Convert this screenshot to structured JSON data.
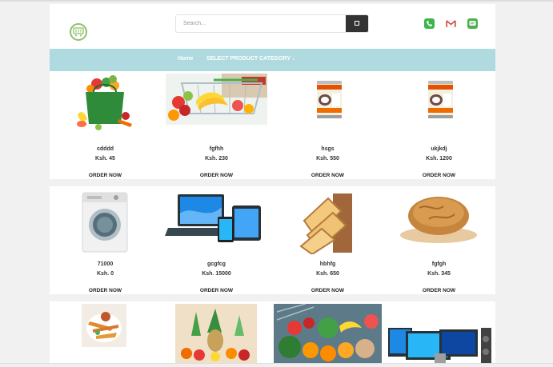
{
  "search": {
    "placeholder": "Search..."
  },
  "nav": {
    "home": "Home",
    "category": "SELECT PRODUCT CATEGORY ↓"
  },
  "contact": [
    "phone-icon",
    "gmail-icon",
    "message-icon"
  ],
  "colors": {
    "navbar": "#afdae0",
    "search_button": "#333333",
    "phone": "#3cb54a",
    "gmail": "#d44638",
    "message": "#4caf50"
  },
  "products_row1": [
    {
      "name": "cdddd",
      "price": "Ksh. 45",
      "order": "ORDER NOW",
      "image": "grocery-bag-image"
    },
    {
      "name": "fgfhh",
      "price": "Ksh. 230",
      "order": "ORDER NOW",
      "image": "shopping-cart-fruits-image"
    },
    {
      "name": "hsgs",
      "price": "Ksh. 550",
      "order": "ORDER NOW",
      "image": "coconut-cream-can-image"
    },
    {
      "name": "ukjkdj",
      "price": "Ksh. 1200",
      "order": "ORDER NOW",
      "image": "coconut-cream-can-image"
    }
  ],
  "products_row2": [
    {
      "name": "71000",
      "price": "Ksh. 0",
      "order": "ORDER NOW",
      "image": "washing-machine-image"
    },
    {
      "name": "gcgfcg",
      "price": "Ksh. 15000",
      "order": "ORDER NOW",
      "image": "laptop-tablet-phone-image"
    },
    {
      "name": "hbhfg",
      "price": "Ksh. 650",
      "order": "ORDER NOW",
      "image": "bread-slices-image"
    },
    {
      "name": "fgfgh",
      "price": "Ksh. 345",
      "order": "ORDER NOW",
      "image": "bread-loaf-image"
    }
  ],
  "products_row3": [
    {
      "image": "fried-food-image"
    },
    {
      "image": "produce-pile-image"
    },
    {
      "image": "vegetable-basket-image"
    },
    {
      "image": "electronics-image"
    }
  ]
}
